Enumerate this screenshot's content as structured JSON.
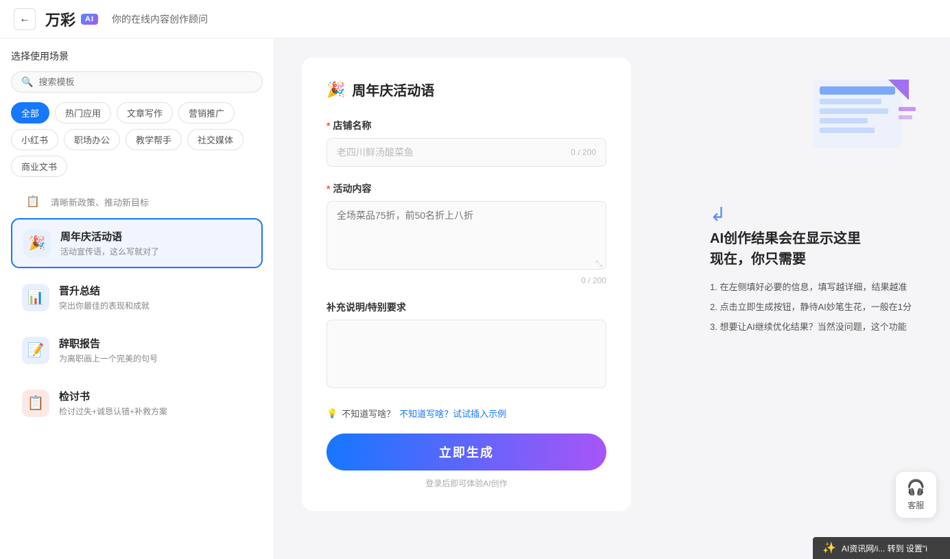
{
  "header": {
    "back_label": "←",
    "logo_text": "万彩",
    "logo_badge": "AI",
    "slogan": "你的在线内容创作顾问"
  },
  "sidebar": {
    "section_title": "选择使用场景",
    "search_placeholder": "搜索模板",
    "categories": [
      {
        "id": "all",
        "label": "全部",
        "active": true
      },
      {
        "id": "hot",
        "label": "热门应用",
        "active": false
      },
      {
        "id": "article",
        "label": "文章写作",
        "active": false
      },
      {
        "id": "marketing",
        "label": "营销推广",
        "active": false
      },
      {
        "id": "xiaohongshu",
        "label": "小红书",
        "active": false
      },
      {
        "id": "office",
        "label": "职场办公",
        "active": false
      },
      {
        "id": "teaching",
        "label": "教学帮手",
        "active": false
      },
      {
        "id": "social",
        "label": "社交媒体",
        "active": false
      },
      {
        "id": "business",
        "label": "商业文书",
        "active": false
      }
    ],
    "narrow_item": {
      "icon": "📋",
      "label": "清晰新政策、推动新目标"
    },
    "items": [
      {
        "id": "anniversary",
        "icon": "🎉",
        "icon_bg": "blue",
        "title": "周年庆活动语",
        "desc": "活动宣传语，这么写就对了",
        "active": true
      },
      {
        "id": "promotion",
        "icon": "📊",
        "icon_bg": "blue",
        "title": "晋升总结",
        "desc": "突出你最佳的表现和成就",
        "active": false
      },
      {
        "id": "resignation",
        "icon": "📝",
        "icon_bg": "blue",
        "title": "辞职报告",
        "desc": "为离职画上一个完美的句号",
        "active": false
      },
      {
        "id": "review",
        "icon": "📋",
        "icon_bg": "red",
        "title": "检讨书",
        "desc": "检讨过失+诚恳认错+补救方案",
        "active": false
      }
    ]
  },
  "form": {
    "title": "周年庆活动语",
    "title_icon": "🎉",
    "fields": [
      {
        "id": "shop_name",
        "label": "店铺名称",
        "required": true,
        "placeholder": "老四川鲜汤酸菜鱼",
        "char_count": "0 / 200",
        "type": "input"
      },
      {
        "id": "activity_content",
        "label": "活动内容",
        "required": true,
        "placeholder": "全场菜品75折，前50名折上八折",
        "char_count": "0 / 200",
        "type": "textarea"
      },
      {
        "id": "extra_note",
        "label": "补充说明/特别要求",
        "required": false,
        "placeholder": "",
        "char_count": "",
        "type": "textarea"
      }
    ],
    "hint_icon": "💡",
    "hint_text": "不知道写啥？试试插入示例",
    "generate_label": "立即生成",
    "login_hint": "登录后即可体验AI创作"
  },
  "right_panel": {
    "ai_hint_title": "AI创作结果会在显示这里\n现在，你只需要",
    "steps": [
      "1. 在左侧填好必要的信息，填写越详细，结果越准",
      "2. 点击立即生成按钮，静待AI妙笔生花，一般在1分",
      "3. 想要让AI继续优化结果？当然没问题，这个功能"
    ]
  },
  "cs": {
    "icon": "🎧",
    "label": "客服"
  },
  "bottom_bar": {
    "icon": "✨",
    "text": "AI资讯网/i... 转到 设置\"i"
  }
}
